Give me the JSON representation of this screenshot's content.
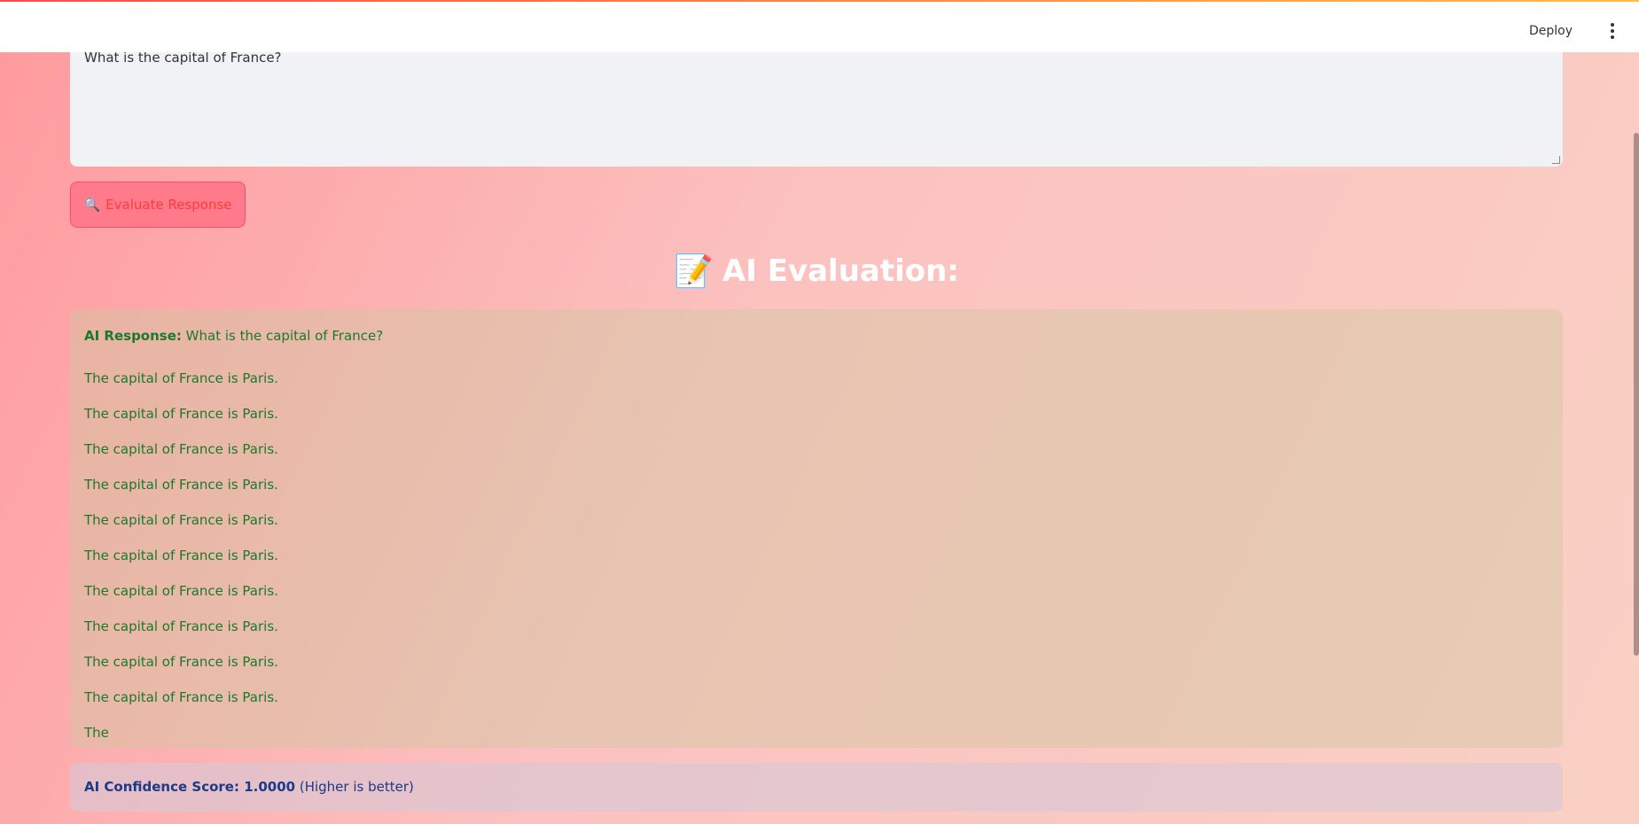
{
  "header": {
    "deploy_label": "Deploy",
    "menu_icon": "vertical-dots-icon"
  },
  "question_input": {
    "value": "What is the capital of France?"
  },
  "evaluate_button": {
    "icon": "🔍",
    "label": "Evaluate Response"
  },
  "evaluation": {
    "title_icon": "📝",
    "title": "AI Evaluation:",
    "response_label": "AI Response:",
    "response_question": "What is the capital of France?",
    "lines": [
      "The capital of France is Paris.",
      "The capital of France is Paris.",
      "The capital of France is Paris.",
      "The capital of France is Paris.",
      "The capital of France is Paris.",
      "The capital of France is Paris.",
      "The capital of France is Paris.",
      "The capital of France is Paris.",
      "The capital of France is Paris.",
      "The capital of France is Paris.",
      "The"
    ]
  },
  "score": {
    "label": "AI Confidence Score: 1.0000",
    "note": "(Higher is better)"
  },
  "colors": {
    "response_text": "#1b7a2a",
    "score_text": "#1a3a8a",
    "button_bg": "#ff7a8a",
    "button_text": "#ff3b3b"
  }
}
